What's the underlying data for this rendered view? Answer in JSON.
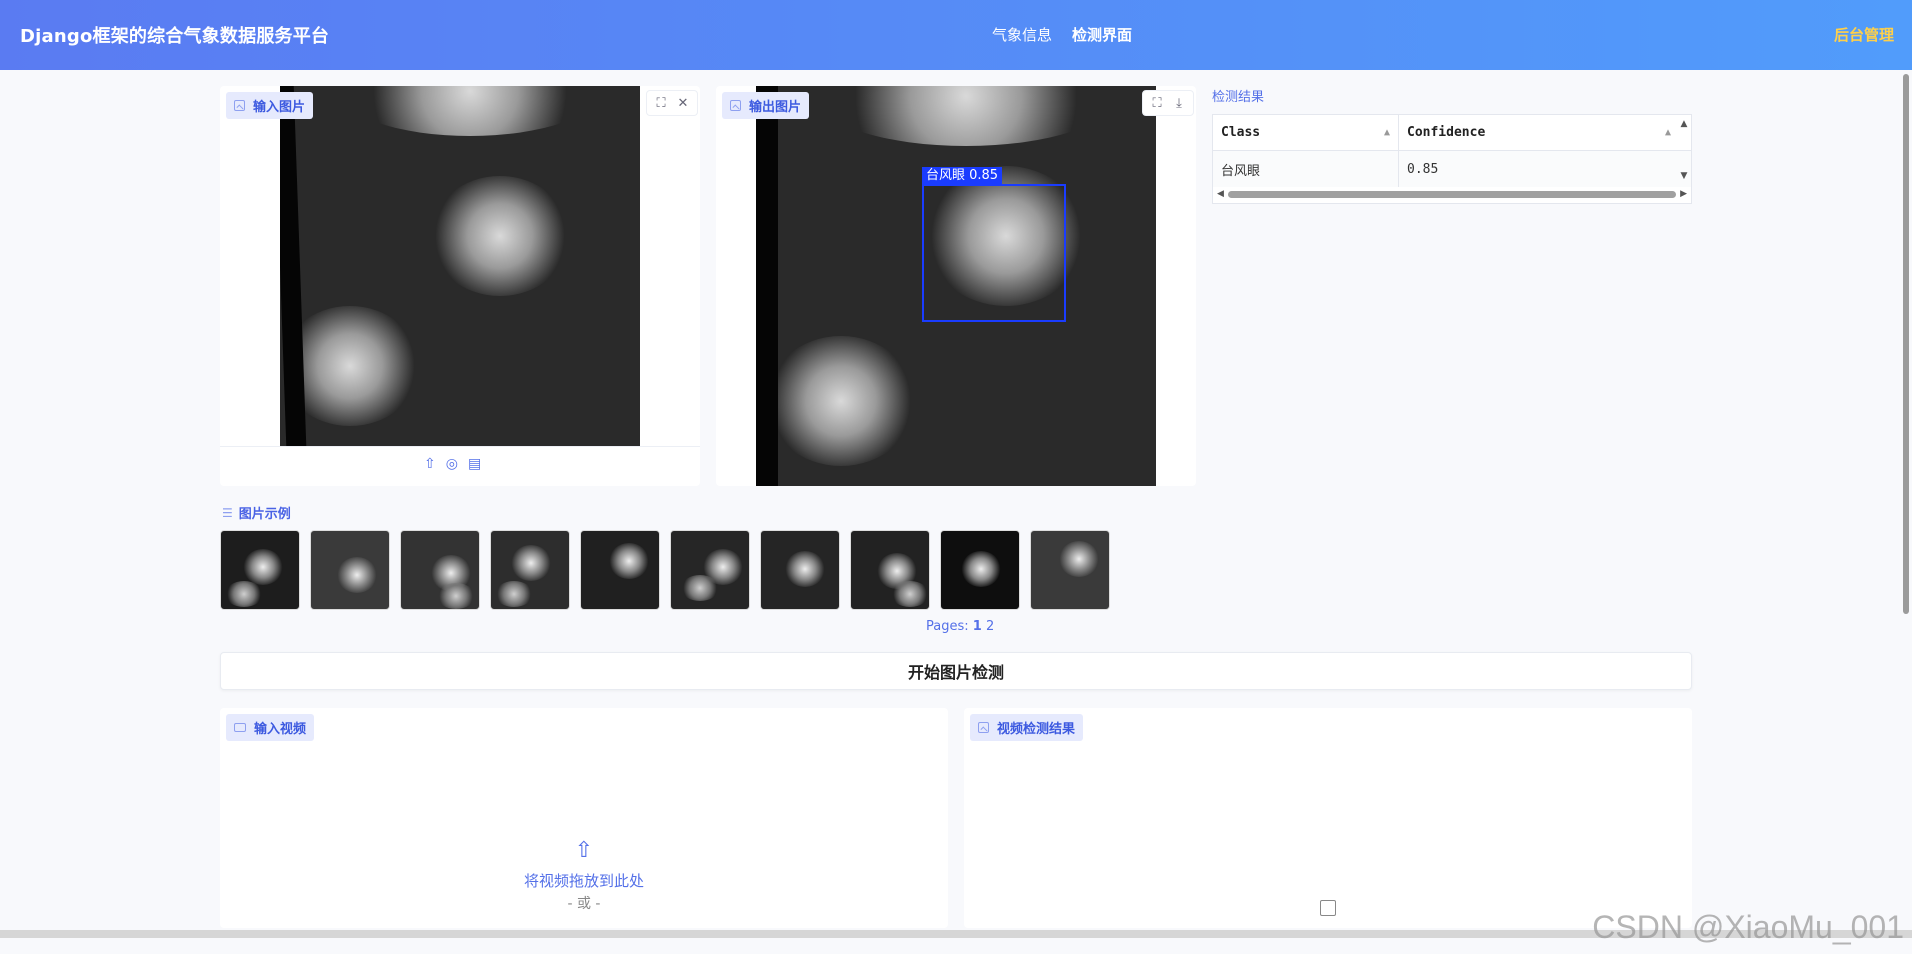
{
  "header": {
    "title": "Django框架的综合气象数据服务平台",
    "nav": [
      "气象信息",
      "检测界面"
    ],
    "admin": "后台管理"
  },
  "input_panel": {
    "label": "输入图片",
    "tools": [
      "fullscreen-icon",
      "close-icon"
    ],
    "actions": [
      "upload-icon",
      "webcam-icon",
      "clipboard-icon"
    ]
  },
  "output_panel": {
    "label": "输出图片",
    "tools": [
      "fullscreen-icon",
      "download-icon"
    ],
    "detection_label": "台风眼 0.85"
  },
  "results": {
    "title": "检测结果",
    "columns": [
      "Class",
      "Confidence"
    ],
    "rows": [
      [
        "台风眼",
        "0.85"
      ]
    ]
  },
  "examples": {
    "title": "图片示例",
    "pages_label": "Pages:",
    "pages": [
      "1",
      "2"
    ],
    "thumb_count": 10
  },
  "start_button": "开始图片检测",
  "video_input": {
    "label": "输入视频",
    "drop_text": "将视频拖放到此处",
    "or_text": "- 或 -"
  },
  "video_output": {
    "label": "视频检测结果"
  },
  "watermark": "CSDN @XiaoMu_001"
}
